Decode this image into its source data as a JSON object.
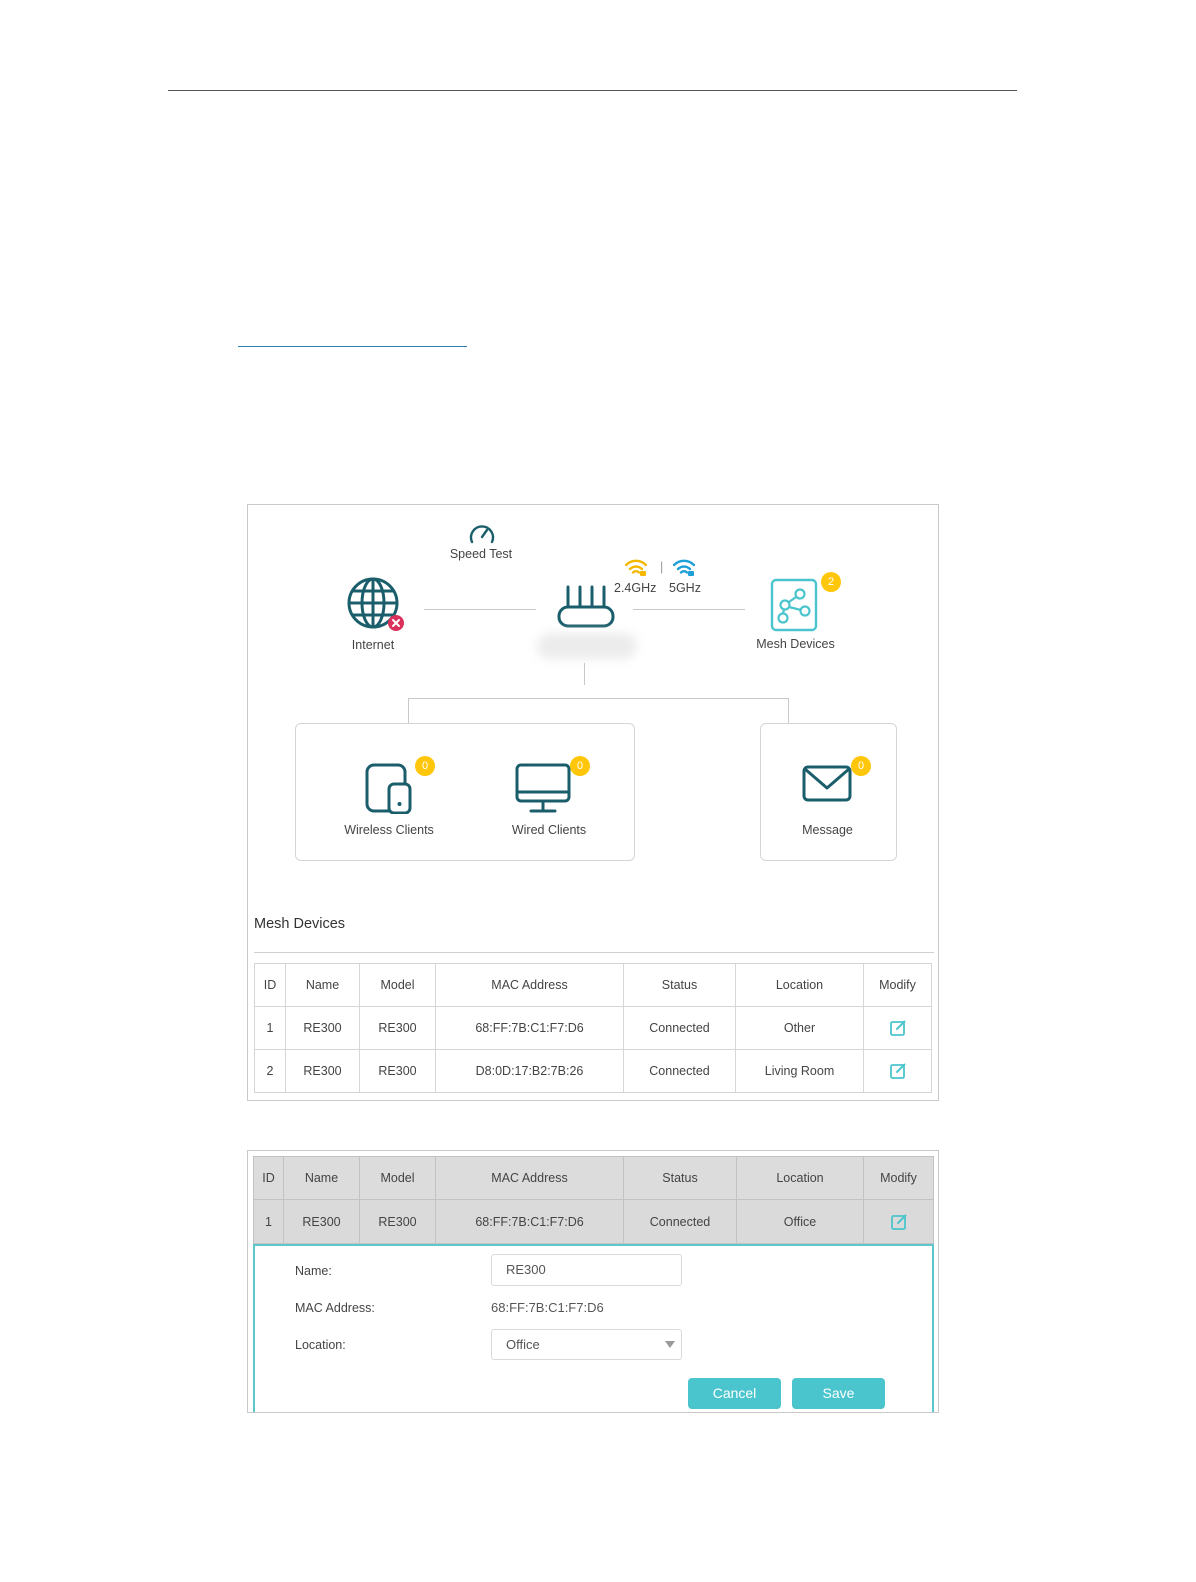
{
  "network_map": {
    "speed_test_label": "Speed Test",
    "internet_label": "Internet",
    "band_24": "2.4GHz",
    "band_separator": "|",
    "band_5": "5GHz",
    "mesh_devices_label": "Mesh Devices",
    "mesh_devices_count": "2",
    "wireless_clients_label": "Wireless Clients",
    "wireless_clients_count": "0",
    "wired_clients_label": "Wired Clients",
    "wired_clients_count": "0",
    "message_label": "Message",
    "message_count": "0"
  },
  "mesh_section": {
    "title": "Mesh Devices",
    "columns": [
      "ID",
      "Name",
      "Model",
      "MAC Address",
      "Status",
      "Location",
      "Modify"
    ],
    "rows": [
      {
        "id": "1",
        "name": "RE300",
        "model": "RE300",
        "mac": "68:FF:7B:C1:F7:D6",
        "status": "Connected",
        "location": "Other"
      },
      {
        "id": "2",
        "name": "RE300",
        "model": "RE300",
        "mac": "D8:0D:17:B2:7B:26",
        "status": "Connected",
        "location": "Living Room"
      }
    ]
  },
  "edit_section": {
    "columns": [
      "ID",
      "Name",
      "Model",
      "MAC Address",
      "Status",
      "Location",
      "Modify"
    ],
    "row": {
      "id": "1",
      "name": "RE300",
      "model": "RE300",
      "mac": "68:FF:7B:C1:F7:D6",
      "status": "Connected",
      "location": "Office"
    },
    "form": {
      "name_label": "Name:",
      "name_value": "RE300",
      "mac_label": "MAC Address:",
      "mac_value": "68:FF:7B:C1:F7:D6",
      "location_label": "Location:",
      "location_value": "Office",
      "cancel_label": "Cancel",
      "save_label": "Save"
    }
  },
  "colors": {
    "teal_dark": "#1b5e6b",
    "teal_accent": "#4bc5cd",
    "badge_yellow": "#ffc60a",
    "wifi_24_color": "#f5b800",
    "wifi_5_color": "#1e9fd6",
    "error_badge": "#d9315b"
  },
  "icons": [
    "speed-test-icon",
    "globe-icon",
    "disconnected-icon",
    "router-icon",
    "wifi-icon",
    "mesh-icon",
    "tablet-phone-icon",
    "monitor-icon",
    "envelope-icon",
    "edit-icon",
    "dropdown-caret-icon"
  ]
}
